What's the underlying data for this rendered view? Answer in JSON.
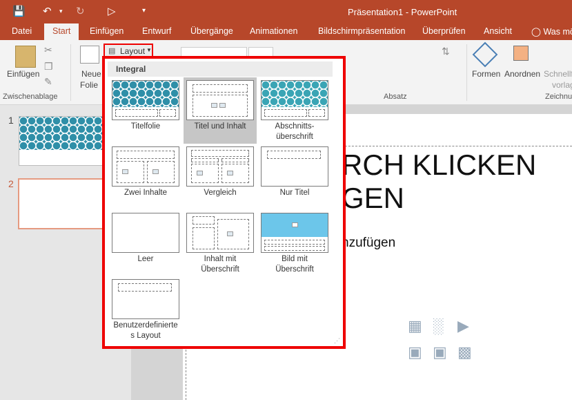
{
  "window": {
    "title": "Präsentation1 - PowerPoint"
  },
  "tabs": [
    {
      "label": "Datei"
    },
    {
      "label": "Start"
    },
    {
      "label": "Einfügen"
    },
    {
      "label": "Entwurf"
    },
    {
      "label": "Übergänge"
    },
    {
      "label": "Animationen"
    },
    {
      "label": "Bildschirmpräsentation"
    },
    {
      "label": "Überprüfen"
    },
    {
      "label": "Ansicht"
    },
    {
      "label": "Was mö"
    }
  ],
  "ribbon": {
    "paste": "Einfügen",
    "new_slide": [
      "Neue",
      "Folie"
    ],
    "layout": "Layout",
    "shapes": "Formen",
    "arrange": "Anordnen",
    "quick_styles": [
      "Schnellf",
      "vorlag"
    ],
    "groups": {
      "clipboard": "Zwischenablage",
      "paragraph": "Absatz",
      "drawing": "Zeichnu"
    }
  },
  "thumbnails": [
    {
      "number": "1"
    },
    {
      "number": "2"
    }
  ],
  "slide": {
    "title_line1": "RCH KLICKEN",
    "title_line2": "GEN",
    "subtitle": "nzufügen"
  },
  "gallery": {
    "heading": "Integral",
    "layouts": [
      {
        "label": "Titelfolie"
      },
      {
        "label": "Titel und Inhalt",
        "selected": true
      },
      {
        "label": "Abschnitts-\nüberschrift"
      },
      {
        "label": "Zwei Inhalte"
      },
      {
        "label": "Vergleich"
      },
      {
        "label": "Nur Titel"
      },
      {
        "label": "Leer"
      },
      {
        "label": "Inhalt mit\nÜberschrift"
      },
      {
        "label": "Bild mit\nÜberschrift"
      },
      {
        "label": "Benutzerdefinierte\ns Layout"
      }
    ]
  },
  "colors": {
    "accent": "#b7472a",
    "highlight": "#ee0000",
    "theme_teal": "#2f8fa8"
  }
}
